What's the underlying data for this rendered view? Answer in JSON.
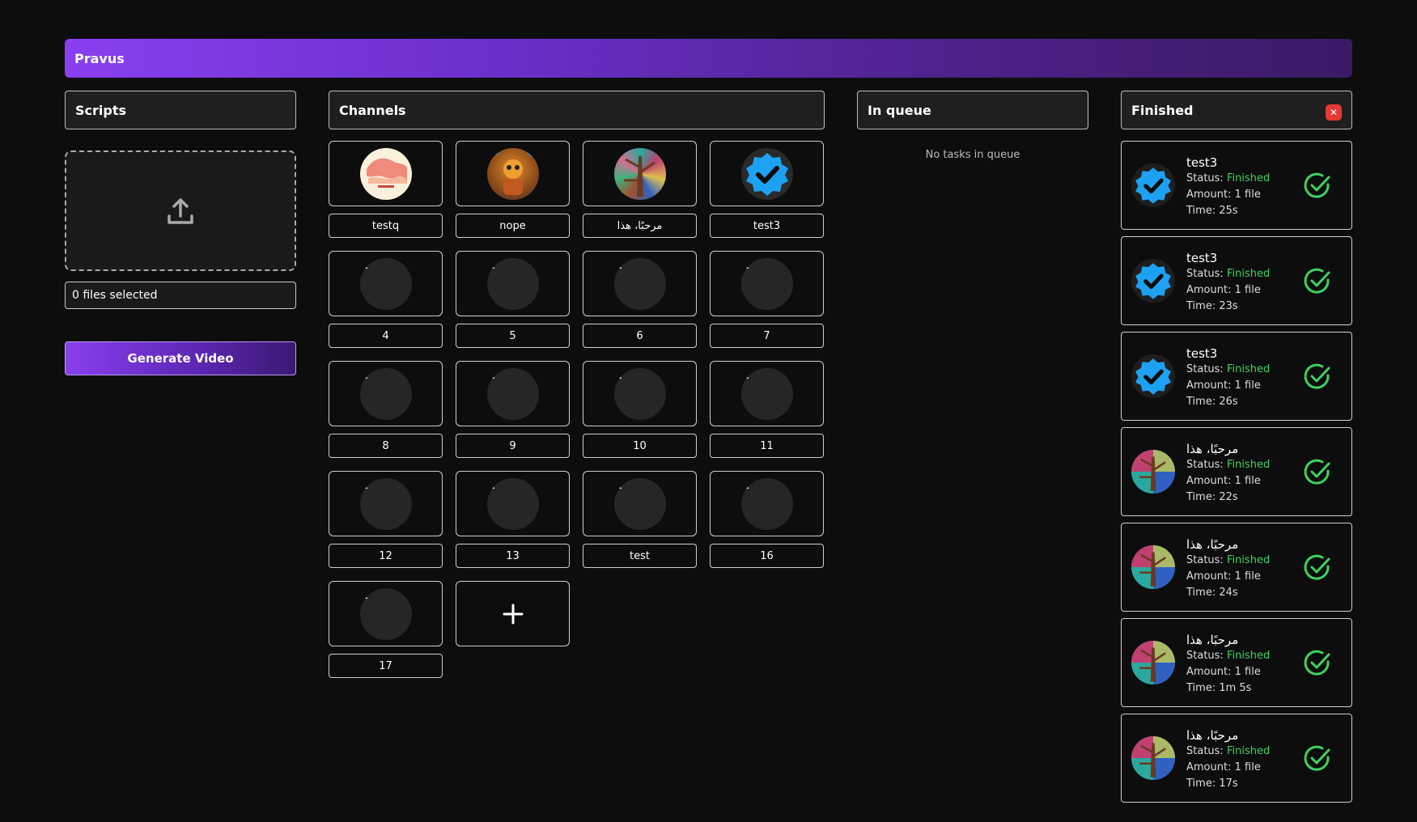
{
  "app": {
    "title": "Pravus"
  },
  "scripts": {
    "header": "Scripts",
    "files_selected": "0 files selected",
    "generate_label": "Generate Video"
  },
  "channels": {
    "header": "Channels",
    "items": [
      {
        "name": "testq",
        "avatar": "levant-image"
      },
      {
        "name": "nope",
        "avatar": "cartoon-image"
      },
      {
        "name": "مرحبًا، هذا",
        "avatar": "collage-image"
      },
      {
        "name": "test3",
        "avatar": "verified-badge"
      },
      {
        "name": "4",
        "avatar": "broken-image"
      },
      {
        "name": "5",
        "avatar": "broken-image"
      },
      {
        "name": "6",
        "avatar": "broken-image"
      },
      {
        "name": "7",
        "avatar": "broken-image"
      },
      {
        "name": "8",
        "avatar": "broken-image"
      },
      {
        "name": "9",
        "avatar": "broken-image"
      },
      {
        "name": "10",
        "avatar": "broken-image"
      },
      {
        "name": "11",
        "avatar": "broken-image"
      },
      {
        "name": "12",
        "avatar": "broken-image"
      },
      {
        "name": "13",
        "avatar": "broken-image"
      },
      {
        "name": "test",
        "avatar": "broken-image"
      },
      {
        "name": "16",
        "avatar": "broken-image"
      },
      {
        "name": "17",
        "avatar": "broken-image"
      }
    ]
  },
  "queue": {
    "header": "In queue",
    "empty_text": "No tasks in queue"
  },
  "finished": {
    "header": "Finished",
    "status_label": "Status:",
    "amount_label": "Amount:",
    "time_label": "Time:",
    "items": [
      {
        "title": "test3",
        "status": "Finished",
        "amount": "1 file",
        "time": "25s",
        "avatar": "verified-badge"
      },
      {
        "title": "test3",
        "status": "Finished",
        "amount": "1 file",
        "time": "23s",
        "avatar": "verified-badge"
      },
      {
        "title": "test3",
        "status": "Finished",
        "amount": "1 file",
        "time": "26s",
        "avatar": "verified-badge"
      },
      {
        "title": "مرحبًا، هذا",
        "status": "Finished",
        "amount": "1 file",
        "time": "22s",
        "avatar": "collage-image"
      },
      {
        "title": "مرحبًا، هذا",
        "status": "Finished",
        "amount": "1 file",
        "time": "24s",
        "avatar": "collage-image"
      },
      {
        "title": "مرحبًا، هذا",
        "status": "Finished",
        "amount": "1 file",
        "time": "1m 5s",
        "avatar": "collage-image"
      },
      {
        "title": "مرحبًا، هذا",
        "status": "Finished",
        "amount": "1 file",
        "time": "17s",
        "avatar": "collage-image"
      }
    ]
  },
  "colors": {
    "accent": "#8a3ff0",
    "success": "#3ed160",
    "danger": "#e53935",
    "verified": "#1da1f2"
  }
}
